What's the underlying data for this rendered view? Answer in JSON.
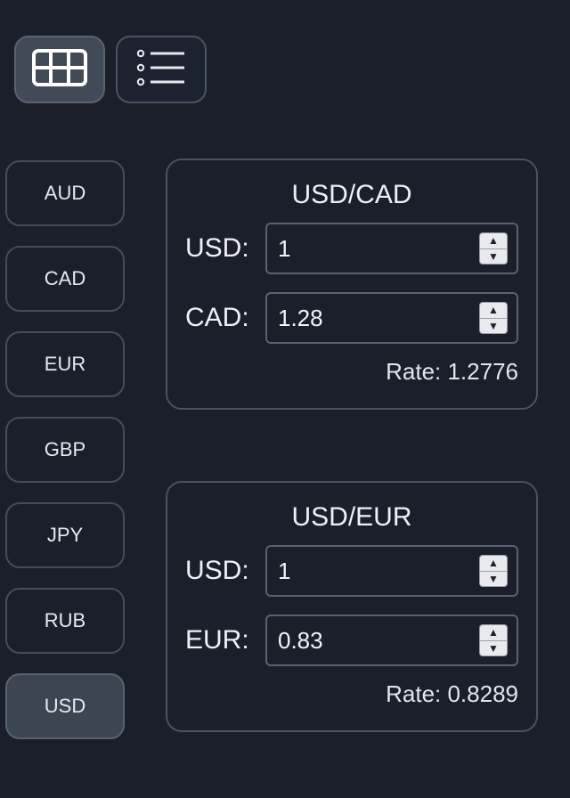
{
  "view_toggle": {
    "grid_icon": "grid-icon",
    "list_icon": "list-icon",
    "active": "grid"
  },
  "currencies": [
    {
      "code": "AUD",
      "active": false
    },
    {
      "code": "CAD",
      "active": false
    },
    {
      "code": "EUR",
      "active": false
    },
    {
      "code": "GBP",
      "active": false
    },
    {
      "code": "JPY",
      "active": false
    },
    {
      "code": "RUB",
      "active": false
    },
    {
      "code": "USD",
      "active": true
    }
  ],
  "pairs": [
    {
      "title": "USD/CAD",
      "base_label": "USD:",
      "base_value": "1",
      "quote_label": "CAD:",
      "quote_value": "1.28",
      "rate_text": "Rate: 1.2776"
    },
    {
      "title": "USD/EUR",
      "base_label": "USD:",
      "base_value": "1",
      "quote_label": "EUR:",
      "quote_value": "0.83",
      "rate_text": "Rate: 0.8289"
    }
  ],
  "colors": {
    "background": "#1a1f2a",
    "border": "#4a5160",
    "active_button": "#3e4552",
    "text": "#e6e9ee"
  }
}
